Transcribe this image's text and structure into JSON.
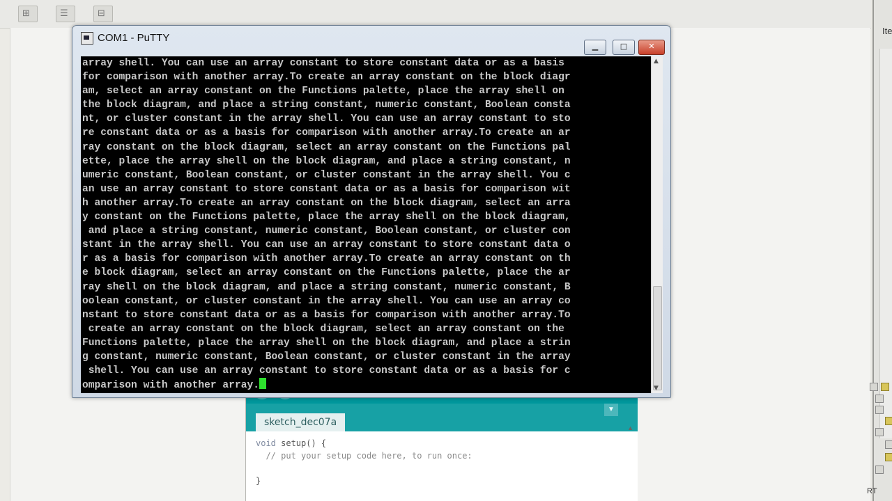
{
  "putty": {
    "title": "COM1 - PuTTY",
    "minimize_label": "▁",
    "maximize_label": "□",
    "close_label": "✕",
    "terminal_lines": [
      "array shell. You can use an array constant to store constant data or as a basis",
      "for comparison with another array.To create an array constant on the block diagr",
      "am, select an array constant on the Functions palette, place the array shell on",
      "the block diagram, and place a string constant, numeric constant, Boolean consta",
      "nt, or cluster constant in the array shell. You can use an array constant to sto",
      "re constant data or as a basis for comparison with another array.To create an ar",
      "ray constant on the block diagram, select an array constant on the Functions pal",
      "ette, place the array shell on the block diagram, and place a string constant, n",
      "umeric constant, Boolean constant, or cluster constant in the array shell. You c",
      "an use an array constant to store constant data or as a basis for comparison wit",
      "h another array.To create an array constant on the block diagram, select an arra",
      "y constant on the Functions palette, place the array shell on the block diagram,",
      " and place a string constant, numeric constant, Boolean constant, or cluster con",
      "stant in the array shell. You can use an array constant to store constant data o",
      "r as a basis for comparison with another array.To create an array constant on th",
      "e block diagram, select an array constant on the Functions palette, place the ar",
      "ray shell on the block diagram, and place a string constant, numeric constant, B",
      "oolean constant, or cluster constant in the array shell. You can use an array co",
      "nstant to store constant data or as a basis for comparison with another array.To",
      " create an array constant on the block diagram, select an array constant on the",
      "Functions palette, place the array shell on the block diagram, and place a strin",
      "g constant, numeric constant, Boolean constant, or cluster constant in the array",
      " shell. You can use an array constant to store constant data or as a basis for c",
      "omparison with another array."
    ],
    "scroll_up_icon": "▲",
    "scroll_down_icon": "▼"
  },
  "arduino": {
    "tab_label": "sketch_dec07a",
    "verify_icon": "✓",
    "upload_icon": "→",
    "new_icon": "▤",
    "open_icon": "↑",
    "save_icon": "↓",
    "serial_monitor_icon": "⌕",
    "tab_menu_icon": "▼",
    "code_line_1_kw": "void",
    "code_line_1_rest": " setup() {",
    "code_line_2": "  // put your setup code here, to run once:",
    "code_line_3": "",
    "code_line_4": "}"
  },
  "background_ide": {
    "right_panel_label": "Ite",
    "right_bottom_label": "RT"
  },
  "colors": {
    "terminal_bg": "#000000",
    "terminal_fg": "#c8c8c8",
    "cursor": "#2ee02e",
    "arduino_teal": "#00979c"
  }
}
